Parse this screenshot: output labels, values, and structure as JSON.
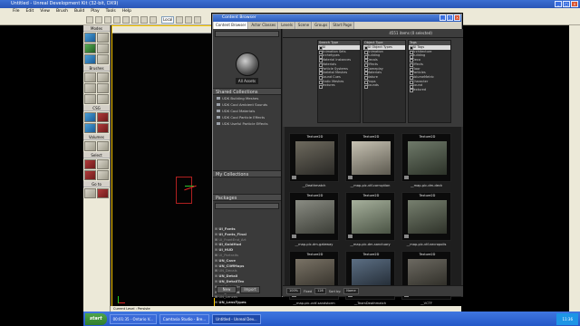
{
  "window": {
    "title": "Untitled - Unreal Development Kit (32-bit, DX9)"
  },
  "menubar": {
    "items": [
      "File",
      "Edit",
      "View",
      "Brush",
      "Build",
      "Play",
      "Tools",
      "Help"
    ]
  },
  "toolbar": {
    "mode_field": "Local"
  },
  "left_panel": {
    "sections": [
      "Modes",
      "Brushes",
      "CSG",
      "Volumes",
      "Select",
      "Go to"
    ]
  },
  "viewport": {
    "label": "Perspective"
  },
  "content_browser": {
    "title": "Content Browser",
    "tabs": [
      "Content Browser",
      "Actor Classes",
      "Levels",
      "Scene",
      "Groups",
      "Start Page"
    ],
    "all_assets_label": "All Assets",
    "shared_collections_header": "Shared Collections",
    "shared_collections": [
      "UDK Building Meshes",
      "UDK Cool Ambient Sounds",
      "UDK Cool Materials",
      "UDK Cool Particle Effects",
      "UDK Useful Particle Effects"
    ],
    "my_collections_header": "My Collections",
    "packages_header": "Packages",
    "packages": [
      {
        "name": "UI_Fonts",
        "bold": true
      },
      {
        "name": "UI_Fonts_Final",
        "bold": true
      },
      {
        "name": "UI_FrontEnd_Art",
        "bold": false
      },
      {
        "name": "UI_GoldHud",
        "bold": true
      },
      {
        "name": "UI_HUD",
        "bold": true
      },
      {
        "name": "UI_Portraits",
        "bold": false
      },
      {
        "name": "UN_Cave",
        "bold": true
      },
      {
        "name": "UN_CliffMaps",
        "bold": true
      },
      {
        "name": "UN_Decals",
        "bold": false
      },
      {
        "name": "UN_Detail",
        "bold": true
      },
      {
        "name": "UN_DetailTex",
        "bold": true
      },
      {
        "name": "UN_DetailTest",
        "bold": false
      },
      {
        "name": "UN_Liandri",
        "bold": true
      },
      {
        "name": "UN_Lenzes",
        "bold": false
      },
      {
        "name": "UN_LensTypes",
        "bold": true
      }
    ],
    "left_footer_buttons": [
      "New",
      "Import"
    ],
    "item_count": "4551 items (0 selected)",
    "filter_columns": [
      {
        "header": "Search Type",
        "items": [
          {
            "label": "All",
            "selected": true
          },
          {
            "label": "Animation Sets",
            "selected": false
          },
          {
            "label": "Archetypes",
            "selected": false
          },
          {
            "label": "Material Instances",
            "selected": false
          },
          {
            "label": "Materials",
            "selected": false
          },
          {
            "label": "Particle Systems",
            "selected": false
          },
          {
            "label": "Skeletal Meshes",
            "selected": false
          },
          {
            "label": "Sound Cues",
            "selected": false
          },
          {
            "label": "Static Meshes",
            "selected": false
          },
          {
            "label": "Textures",
            "selected": false
          }
        ]
      },
      {
        "header": "Object Type",
        "items": [
          {
            "label": "All Object Types",
            "selected": true
          },
          {
            "label": "Animation",
            "selected": false
          },
          {
            "label": "Building",
            "selected": false
          },
          {
            "label": "Decals",
            "selected": false
          },
          {
            "label": "Effects",
            "selected": false
          },
          {
            "label": "Gameplay",
            "selected": false
          },
          {
            "label": "Materials",
            "selected": false
          },
          {
            "label": "Nature",
            "selected": false
          },
          {
            "label": "Props",
            "selected": false
          },
          {
            "label": "Sounds",
            "selected": false
          }
        ]
      },
      {
        "header": "Tags",
        "items": [
          {
            "label": "All Tags",
            "selected": true
          },
          {
            "label": "Architecture",
            "selected": false
          },
          {
            "label": "Building",
            "selected": false
          },
          {
            "label": "Deco",
            "selected": false
          },
          {
            "label": "Effects",
            "selected": false
          },
          {
            "label": "Floor",
            "selected": false
          },
          {
            "label": "Particles",
            "selected": false
          },
          {
            "label": "VolumeMetric",
            "selected": false
          },
          {
            "label": "Character",
            "selected": false
          },
          {
            "label": "Sound",
            "selected": false
          },
          {
            "label": "Textured",
            "selected": false
          }
        ]
      }
    ],
    "thumbnails": [
      {
        "type": "Texture2D",
        "label": "__Deathmatch",
        "c1": "#6e6a5e",
        "c2": "#2a2926"
      },
      {
        "type": "Texture2D",
        "label": "__map-pic-vtf-corruption",
        "c1": "#c7c2b3",
        "c2": "#5c594f"
      },
      {
        "type": "Texture2D",
        "label": "__map-pic-dm-deck",
        "c1": "#6f7a6a",
        "c2": "#2c3228"
      },
      {
        "type": "Texture2D",
        "label": "__map-pic-dm-gateway",
        "c1": "#8a8c83",
        "c2": "#3b3d36"
      },
      {
        "type": "Texture2D",
        "label": "__map-pic-dm-sanctuary",
        "c1": "#a6b09c",
        "c2": "#4a5344"
      },
      {
        "type": "Texture2D",
        "label": "__map-pic-vtf-necropolis",
        "c1": "#77806f",
        "c2": "#2e3229"
      },
      {
        "type": "Texture2D",
        "label": "__map-pic-vctf-sandstorm",
        "c1": "#7a7366",
        "c2": "#2d2a24"
      },
      {
        "type": "Texture2D",
        "label": "__TeamDeathmatch",
        "c1": "#5c6f84",
        "c2": "#1c232b"
      },
      {
        "type": "Texture2D",
        "label": "__VCTF",
        "c1": "#6d6a62",
        "c2": "#26251f"
      }
    ],
    "bottom_bar": {
      "zoom": "100%",
      "fixed_label": "Fixed",
      "size_value": "128",
      "sort_label": "Sort by:",
      "sort_value": "Name"
    }
  },
  "status_bar": {
    "text": "Current Level : Persiste"
  },
  "taskbar": {
    "start_label": "start",
    "items": [
      {
        "label": "00:01:35 - Ontario V...",
        "active": false
      },
      {
        "label": "Camtasia Studio - Bre...",
        "active": false
      },
      {
        "label": "Untitled - Unreal Dev...",
        "active": true
      }
    ],
    "clock": "11:36"
  }
}
